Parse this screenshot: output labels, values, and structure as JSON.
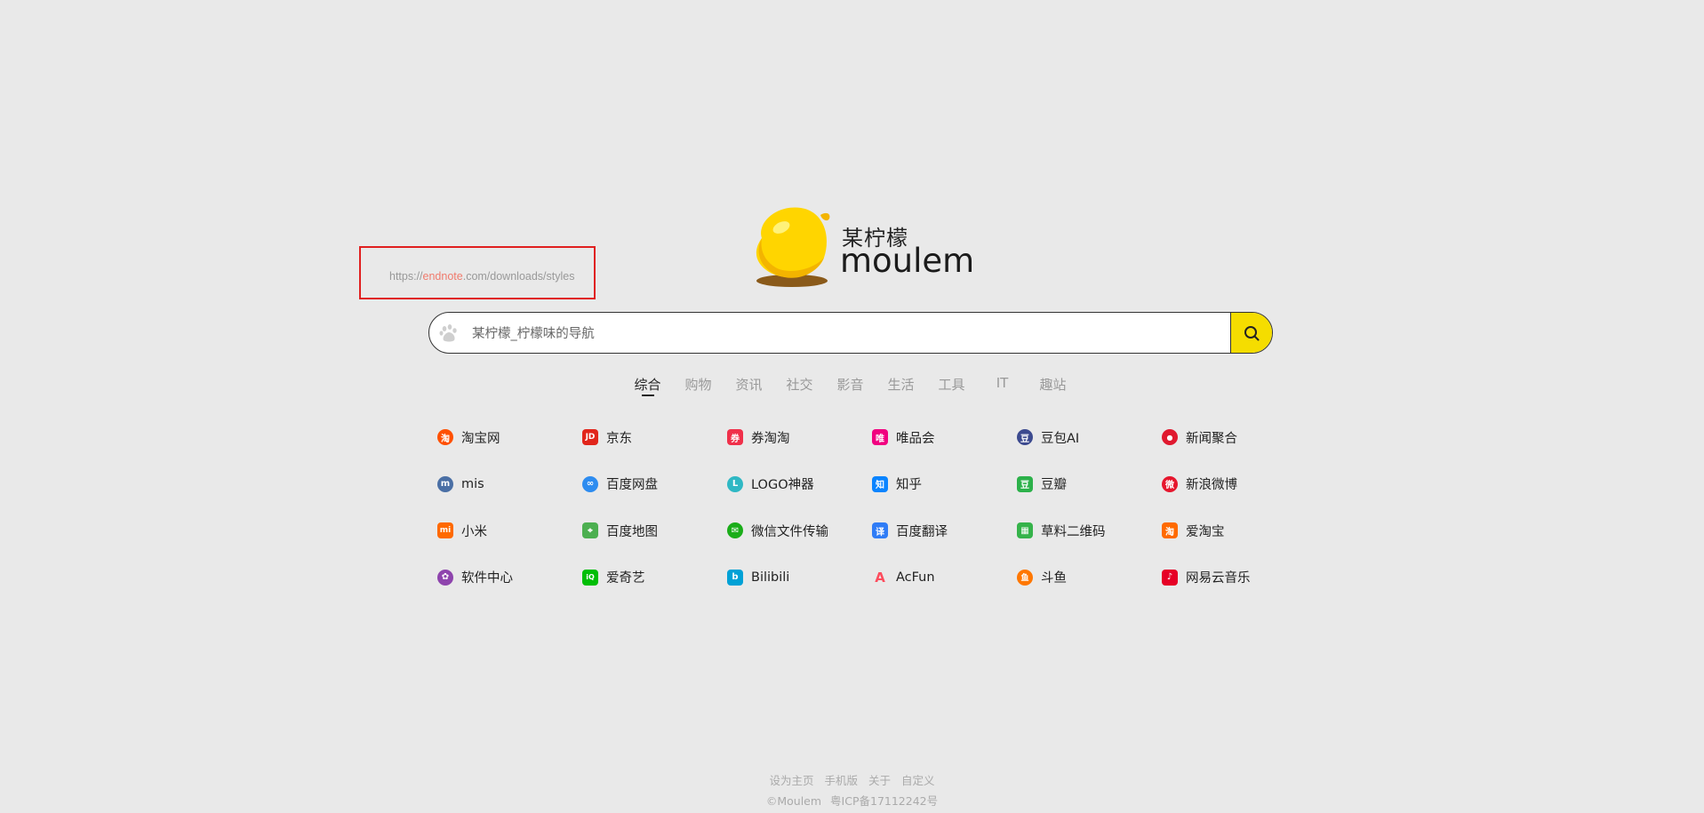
{
  "logo": {
    "cn_text": "某柠檬",
    "en_text": "moulem"
  },
  "highlight_url": {
    "prefix": "https://",
    "highlight": "endnote",
    "suffix": ".com/downloads/styles"
  },
  "search": {
    "placeholder": "某柠檬_柠檬味的导航",
    "engine_icon": "baidu-paw-icon",
    "button_icon": "search-icon"
  },
  "tabs": [
    "综合",
    "购物",
    "资讯",
    "社交",
    "影音",
    "生活",
    "工具",
    "IT",
    "趣站"
  ],
  "active_tab": "综合",
  "links": [
    [
      {
        "label": "淘宝网",
        "icon": "taobao-icon",
        "color": "#ff5000",
        "glyph": "淘"
      },
      {
        "label": "京东",
        "icon": "jd-icon",
        "color": "#e1251b",
        "glyph": "JD"
      },
      {
        "label": "券淘淘",
        "icon": "quantaotao-icon",
        "color": "#f0304a",
        "glyph": "券"
      },
      {
        "label": "唯品会",
        "icon": "vip-icon",
        "color": "#f10180",
        "glyph": "唯"
      },
      {
        "label": "豆包AI",
        "icon": "doubao-icon",
        "color": "#3c4a8f",
        "glyph": "豆"
      },
      {
        "label": "新闻聚合",
        "icon": "news-icon",
        "color": "#e0192f",
        "glyph": "●"
      }
    ],
    [
      {
        "label": "mis",
        "icon": "mis-icon",
        "color": "#4a6fa5",
        "glyph": "m"
      },
      {
        "label": "百度网盘",
        "icon": "baidu-pan-icon",
        "color": "#2d8cf0",
        "glyph": "∞"
      },
      {
        "label": "LOGO神器",
        "icon": "logo-tool-icon",
        "color": "#2fb8c4",
        "glyph": "L"
      },
      {
        "label": "知乎",
        "icon": "zhihu-icon",
        "color": "#0a84ff",
        "glyph": "知"
      },
      {
        "label": "豆瓣",
        "icon": "douban-icon",
        "color": "#2cb14a",
        "glyph": "豆"
      },
      {
        "label": "新浪微博",
        "icon": "weibo-icon",
        "color": "#e6162d",
        "glyph": "微"
      }
    ],
    [
      {
        "label": "小米",
        "icon": "xiaomi-icon",
        "color": "#ff6900",
        "glyph": "mi"
      },
      {
        "label": "百度地图",
        "icon": "baidu-map-icon",
        "color": "#4caf50",
        "glyph": "⌖"
      },
      {
        "label": "微信文件传输",
        "icon": "wechat-icon",
        "color": "#1aad19",
        "glyph": "✉"
      },
      {
        "label": "百度翻译",
        "icon": "baidu-translate-icon",
        "color": "#2f7cf6",
        "glyph": "译"
      },
      {
        "label": "草料二维码",
        "icon": "qrcode-icon",
        "color": "#35b34a",
        "glyph": "▦"
      },
      {
        "label": "爱淘宝",
        "icon": "aitaobao-icon",
        "color": "#ff6a00",
        "glyph": "淘"
      }
    ],
    [
      {
        "label": "软件中心",
        "icon": "software-center-icon",
        "color": "#8e44ad",
        "glyph": "✿"
      },
      {
        "label": "爱奇艺",
        "icon": "iqiyi-icon",
        "color": "#00be06",
        "glyph": "iQ"
      },
      {
        "label": "Bilibili",
        "icon": "bilibili-icon",
        "color": "#00a1d6",
        "glyph": "b"
      },
      {
        "label": "AcFun",
        "icon": "acfun-icon",
        "color": "#fd4c5d",
        "glyph": "A"
      },
      {
        "label": "斗鱼",
        "icon": "douyu-icon",
        "color": "#ff7700",
        "glyph": "鱼"
      },
      {
        "label": "网易云音乐",
        "icon": "netease-music-icon",
        "color": "#e60026",
        "glyph": "♪"
      }
    ]
  ],
  "footer": {
    "links": [
      "设为主页",
      "手机版",
      "关于",
      "自定义"
    ],
    "copyright": "©Moulem",
    "icp": "粤ICP备17112242号"
  }
}
